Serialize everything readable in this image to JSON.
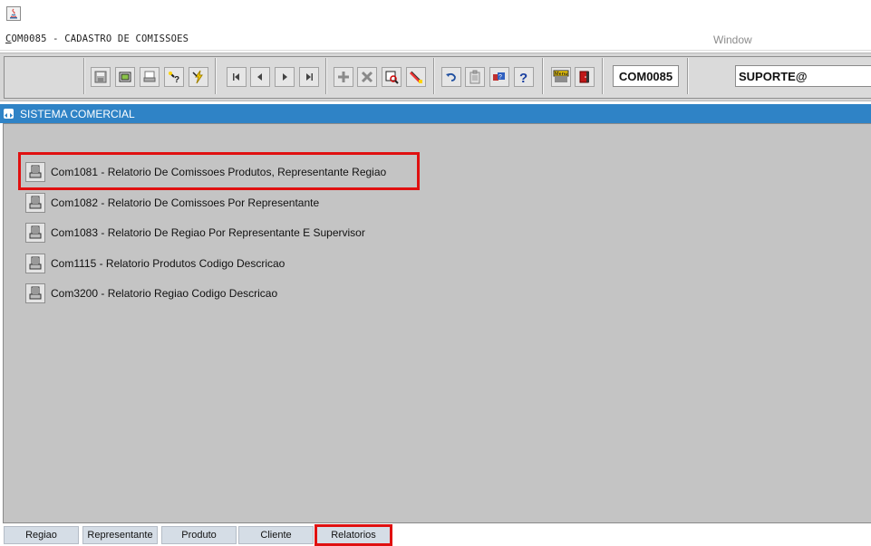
{
  "window": {
    "title_prefix": "C",
    "title_rest": "OM0085 - CADASTRO DE COMISSOES",
    "menu_window": "Window"
  },
  "toolbar": {
    "module_code": "COM0085",
    "user": "SUPORTE@",
    "buttons": [
      {
        "name": "save-icon"
      },
      {
        "name": "window-icon"
      },
      {
        "name": "print-icon"
      },
      {
        "name": "query-help-icon"
      },
      {
        "name": "execute-query-icon"
      },
      {
        "name": "first-record-icon"
      },
      {
        "name": "previous-record-icon"
      },
      {
        "name": "next-record-icon"
      },
      {
        "name": "last-record-icon"
      },
      {
        "name": "insert-record-icon"
      },
      {
        "name": "delete-record-icon"
      },
      {
        "name": "view-icon"
      },
      {
        "name": "edit-icon"
      },
      {
        "name": "undo-icon"
      },
      {
        "name": "clipboard-icon"
      },
      {
        "name": "options-icon"
      },
      {
        "name": "help-icon"
      },
      {
        "name": "menu-icon",
        "label": "Menu"
      },
      {
        "name": "exit-icon"
      }
    ]
  },
  "section": {
    "title": "SISTEMA COMERCIAL"
  },
  "reports": [
    {
      "label": "Com1081 - Relatorio De Comissoes Produtos, Representante Regiao"
    },
    {
      "label": "Com1082 - Relatorio De Comissoes Por Representante"
    },
    {
      "label": "Com1083 - Relatorio De Regiao Por Representante E Supervisor"
    },
    {
      "label": "Com1115 - Relatorio Produtos Codigo Descricao"
    },
    {
      "label": "Com3200 - Relatorio Regiao Codigo Descricao"
    }
  ],
  "tabs": [
    {
      "label": "Regiao"
    },
    {
      "label": "Representante"
    },
    {
      "label": "Produto"
    },
    {
      "label": "Cliente"
    },
    {
      "label": "Relatorios",
      "active": true
    }
  ],
  "colors": {
    "section_bar": "#2f83c6",
    "highlight": "#e01010",
    "panel_bg": "#c4c4c4"
  }
}
